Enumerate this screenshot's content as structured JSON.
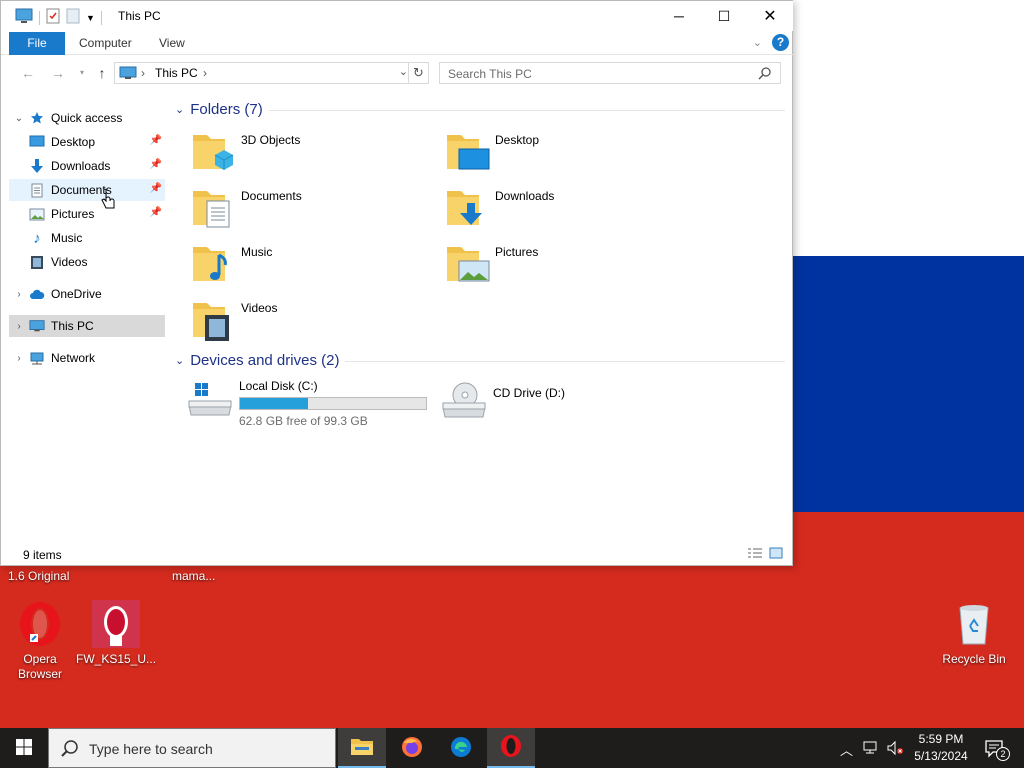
{
  "window": {
    "title": "This PC",
    "ribbon_tabs": [
      "File",
      "Computer",
      "View"
    ]
  },
  "address": {
    "crumbs": [
      "This PC"
    ]
  },
  "search": {
    "placeholder": "Search This PC"
  },
  "sidebar": {
    "items": [
      {
        "label": "Quick access",
        "icon": "star-icon"
      },
      {
        "label": "Desktop",
        "icon": "desktop-icon",
        "pinned": true
      },
      {
        "label": "Downloads",
        "icon": "download-icon",
        "pinned": true
      },
      {
        "label": "Documents",
        "icon": "document-icon",
        "pinned": true
      },
      {
        "label": "Pictures",
        "icon": "picture-icon",
        "pinned": true
      },
      {
        "label": "Music",
        "icon": "music-icon"
      },
      {
        "label": "Videos",
        "icon": "video-icon"
      },
      {
        "label": "OneDrive",
        "icon": "cloud-icon"
      },
      {
        "label": "This PC",
        "icon": "computer-icon"
      },
      {
        "label": "Network",
        "icon": "network-icon"
      }
    ]
  },
  "content": {
    "folders_header": "Folders (7)",
    "folders": [
      "3D Objects",
      "Desktop",
      "Documents",
      "Downloads",
      "Music",
      "Pictures",
      "Videos"
    ],
    "drives_header": "Devices and drives (2)",
    "drives": [
      {
        "name": "Local Disk (C:)",
        "free": "62.8 GB free of 99.3 GB",
        "used_fraction": 0.368
      },
      {
        "name": "CD Drive (D:)"
      }
    ]
  },
  "status": {
    "count": "9 items"
  },
  "desktop": {
    "partial_labels": [
      "1.6 Original",
      "mama..."
    ],
    "icons": [
      {
        "label": "Opera Browser"
      },
      {
        "label": "FW_KS15_U..."
      },
      {
        "label": "Recycle Bin"
      }
    ]
  },
  "taskbar": {
    "search_placeholder": "Type here to search",
    "time": "5:59 PM",
    "date": "5/13/2024",
    "notification_count": "2"
  },
  "colors": {
    "accent": "#1979ca",
    "flag_white": "#ffffff",
    "flag_blue": "#0033a0",
    "flag_red": "#d52b1e"
  }
}
